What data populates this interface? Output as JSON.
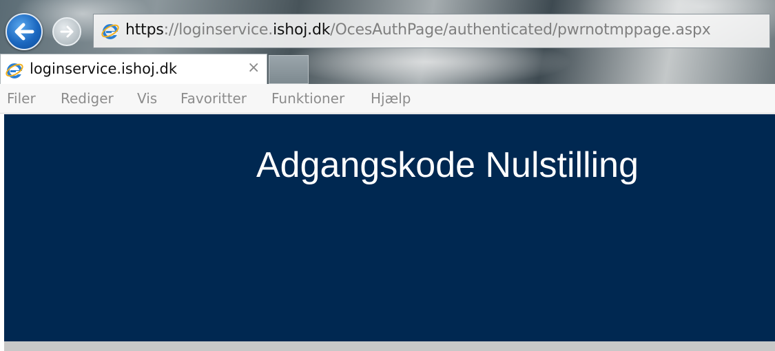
{
  "browser": {
    "address": {
      "scheme": "https",
      "separator": "://",
      "domain_prefix": "loginservice.",
      "domain_main": "ishoj.dk",
      "path": "/OcesAuthPage/authenticated/pwrnotmppage.aspx"
    },
    "tab": {
      "label": "loginservice.ishoj.dk",
      "close": "×"
    },
    "menu": {
      "items": [
        "Filer",
        "Rediger",
        "Vis",
        "Favoritter",
        "Funktioner",
        "Hjælp"
      ]
    },
    "icons": {
      "back": "back-arrow-icon",
      "forward": "forward-arrow-icon",
      "site": "internet-explorer-icon"
    }
  },
  "page": {
    "title": "Adgangskode Nulstilling"
  },
  "colors": {
    "header_background": "#002851",
    "title_text": "#ffffff",
    "menu_text": "#8c8c8c"
  }
}
